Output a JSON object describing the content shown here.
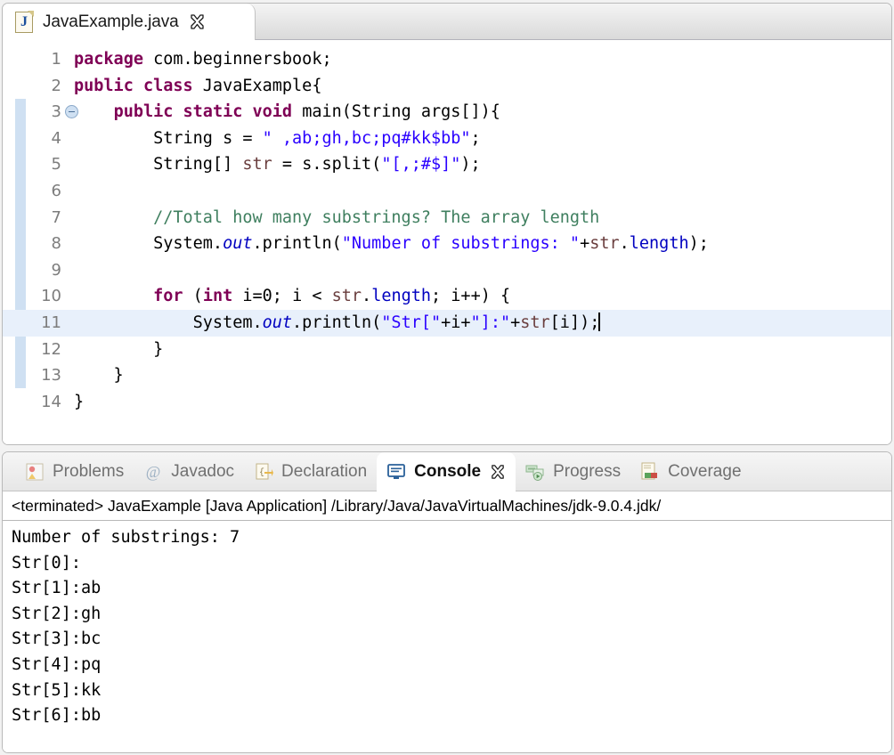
{
  "editor": {
    "tab": {
      "filename": "JavaExample.java",
      "icon": "java-file-icon",
      "close_icon": "close-icon",
      "letter": "J"
    },
    "lines": [
      {
        "num": "1",
        "foldable": false,
        "current": false,
        "tokens": [
          {
            "t": "package ",
            "c": "kw"
          },
          {
            "t": "com.beginnersbook;",
            "c": ""
          }
        ]
      },
      {
        "num": "2",
        "foldable": false,
        "current": false,
        "tokens": [
          {
            "t": "public class ",
            "c": "kw"
          },
          {
            "t": "JavaExample{",
            "c": ""
          }
        ]
      },
      {
        "num": "3",
        "foldable": true,
        "current": false,
        "tokens": [
          {
            "t": "    ",
            "c": ""
          },
          {
            "t": "public static void ",
            "c": "kw"
          },
          {
            "t": "main(String args[]){",
            "c": ""
          }
        ]
      },
      {
        "num": "4",
        "foldable": false,
        "current": false,
        "tokens": [
          {
            "t": "        String s = ",
            "c": ""
          },
          {
            "t": "\" ,ab;gh,bc;pq#kk$bb\"",
            "c": "str"
          },
          {
            "t": ";",
            "c": ""
          }
        ]
      },
      {
        "num": "5",
        "foldable": false,
        "current": false,
        "tokens": [
          {
            "t": "        String[] ",
            "c": ""
          },
          {
            "t": "str",
            "c": "loc"
          },
          {
            "t": " = s.split(",
            "c": ""
          },
          {
            "t": "\"[,;#$]\"",
            "c": "str"
          },
          {
            "t": ");",
            "c": ""
          }
        ]
      },
      {
        "num": "6",
        "foldable": false,
        "current": false,
        "tokens": []
      },
      {
        "num": "7",
        "foldable": false,
        "current": false,
        "tokens": [
          {
            "t": "        //Total how many substrings? The array length",
            "c": "cmt"
          }
        ]
      },
      {
        "num": "8",
        "foldable": false,
        "current": false,
        "tokens": [
          {
            "t": "        System.",
            "c": ""
          },
          {
            "t": "out",
            "c": "fld"
          },
          {
            "t": ".println(",
            "c": ""
          },
          {
            "t": "\"Number of substrings: \"",
            "c": "str"
          },
          {
            "t": "+",
            "c": ""
          },
          {
            "t": "str",
            "c": "loc"
          },
          {
            "t": ".",
            "c": ""
          },
          {
            "t": "length",
            "c": "stf"
          },
          {
            "t": ");",
            "c": ""
          }
        ]
      },
      {
        "num": "9",
        "foldable": false,
        "current": false,
        "tokens": []
      },
      {
        "num": "10",
        "foldable": false,
        "current": false,
        "tokens": [
          {
            "t": "        ",
            "c": ""
          },
          {
            "t": "for ",
            "c": "kw"
          },
          {
            "t": "(",
            "c": ""
          },
          {
            "t": "int ",
            "c": "kw"
          },
          {
            "t": "i=0; i < ",
            "c": ""
          },
          {
            "t": "str",
            "c": "loc"
          },
          {
            "t": ".",
            "c": ""
          },
          {
            "t": "length",
            "c": "stf"
          },
          {
            "t": "; i++) {",
            "c": ""
          }
        ]
      },
      {
        "num": "11",
        "foldable": false,
        "current": true,
        "cursor": true,
        "tokens": [
          {
            "t": "            System.",
            "c": ""
          },
          {
            "t": "out",
            "c": "fld"
          },
          {
            "t": ".println(",
            "c": ""
          },
          {
            "t": "\"Str[\"",
            "c": "str"
          },
          {
            "t": "+i+",
            "c": ""
          },
          {
            "t": "\"]:\"",
            "c": "str"
          },
          {
            "t": "+",
            "c": ""
          },
          {
            "t": "str",
            "c": "loc"
          },
          {
            "t": "[i]);",
            "c": ""
          }
        ]
      },
      {
        "num": "12",
        "foldable": false,
        "current": false,
        "tokens": [
          {
            "t": "        }",
            "c": ""
          }
        ]
      },
      {
        "num": "13",
        "foldable": false,
        "current": false,
        "tokens": [
          {
            "t": "    }",
            "c": ""
          }
        ]
      },
      {
        "num": "14",
        "foldable": false,
        "current": false,
        "tokens": [
          {
            "t": "}",
            "c": ""
          }
        ]
      }
    ]
  },
  "bottom_panel": {
    "tabs": [
      {
        "label": "Problems",
        "icon": "problems-icon",
        "active": false
      },
      {
        "label": "Javadoc",
        "icon": "at-sign-icon",
        "active": false
      },
      {
        "label": "Declaration",
        "icon": "declaration-icon",
        "active": false
      },
      {
        "label": "Console",
        "icon": "console-icon",
        "active": true,
        "close_icon": "close-icon"
      },
      {
        "label": "Progress",
        "icon": "progress-icon",
        "active": false
      },
      {
        "label": "Coverage",
        "icon": "coverage-icon",
        "active": false
      }
    ],
    "console": {
      "launch_line": "<terminated> JavaExample [Java Application] /Library/Java/JavaVirtualMachines/jdk-9.0.4.jdk/",
      "output": [
        "Number of substrings: 7",
        "Str[0]:",
        "Str[1]:ab",
        "Str[2]:gh",
        "Str[3]:bc",
        "Str[4]:pq",
        "Str[5]:kk",
        "Str[6]:bb"
      ]
    }
  },
  "colors": {
    "keyword": "#7f0055",
    "string": "#2a00ff",
    "comment": "#3f7f5f",
    "field": "#0000c0",
    "local": "#6a3e3e",
    "current_line": "#e8f0fb",
    "method_range": "#cfe0f2"
  }
}
